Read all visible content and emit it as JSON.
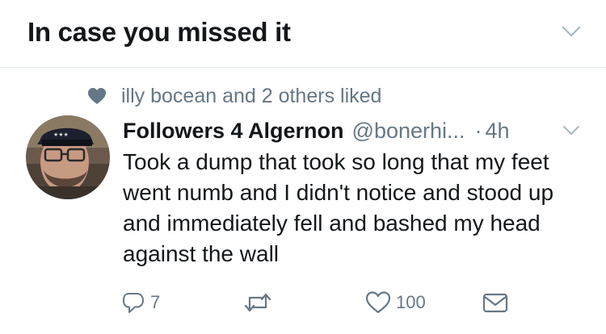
{
  "section": {
    "title": "In case you missed it",
    "chevron_icon": "chevron-down-icon"
  },
  "social_context": {
    "icon": "heart-filled-icon",
    "text": "illy bocean and 2 others liked"
  },
  "tweet": {
    "display_name": "Followers 4 Algernon",
    "handle": "@bonerhi...",
    "separator": "·",
    "timestamp": "4h",
    "text": "Took a dump that took so long that my feet went numb and I didn't notice and stood up and immediately fell and bashed my head against the wall",
    "menu_icon": "chevron-down-icon",
    "actions": {
      "reply_count": "7",
      "retweet_count": "",
      "like_count": "100",
      "reply_icon": "reply-icon",
      "retweet_icon": "retweet-icon",
      "like_icon": "heart-outline-icon",
      "dm_icon": "envelope-icon"
    }
  },
  "colors": {
    "text_primary": "#14171a",
    "text_secondary": "#657786",
    "divider": "#e1e8ed",
    "icon_gray": "#657786"
  }
}
